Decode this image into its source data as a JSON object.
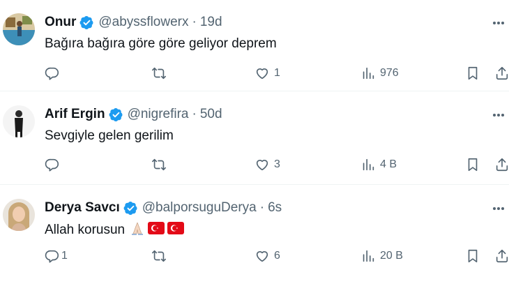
{
  "tweets": [
    {
      "name": "Onur",
      "handle": "@abyssflowerx",
      "separator": "·",
      "age": "19d",
      "text": "Bağıra bağıra göre göre geliyor deprem",
      "replies": "",
      "likes": "1",
      "views": "976",
      "avatar_icon": "profile-photo-pool"
    },
    {
      "name": "Arif Ergin",
      "handle": "@nigrefira",
      "separator": "·",
      "age": "50d",
      "text": "Sevgiyle gelen gerilim",
      "replies": "",
      "likes": "3",
      "views": "4 B",
      "avatar_icon": "profile-photo-person-standing"
    },
    {
      "name": "Derya Savcı",
      "handle": "@balporsuguDerya",
      "separator": "·",
      "age": "6s",
      "text": "Allah korusun",
      "replies": "1",
      "likes": "6",
      "views": "20 B",
      "avatar_icon": "profile-photo-woman",
      "emojis": [
        "praying-hands-emoji",
        "turkey-flag-emoji",
        "turkey-flag-emoji"
      ]
    }
  ],
  "colors": {
    "verified": "#1d9bf0",
    "muted": "#536471",
    "text": "#0f1419",
    "flag": "#e30a17"
  }
}
